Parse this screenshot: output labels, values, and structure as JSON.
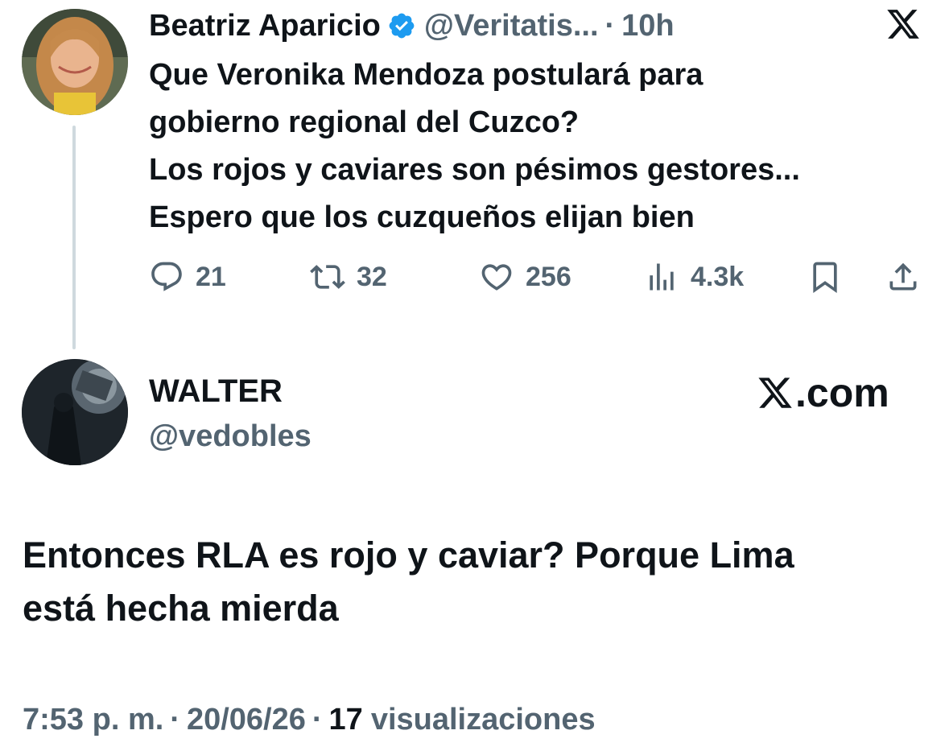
{
  "parent_tweet": {
    "author_name": "Beatriz Aparicio",
    "handle": "@Veritatis...",
    "separator": "·",
    "time": "10h",
    "text_lines": [
      "Que Veronika Mendoza postulará para",
      "gobierno regional del Cuzco?",
      "Los rojos y caviares son pésimos gestores...",
      "Espero que los cuzqueños elijan bien"
    ],
    "stats": {
      "replies": "21",
      "reposts": "32",
      "likes": "256",
      "views": "4.3k"
    }
  },
  "reply_tweet": {
    "author_name": "WALTER",
    "handle": "@vedobles",
    "brand_suffix": ".com",
    "text_lines": [
      "Entonces RLA es rojo y caviar? Porque Lima",
      "está hecha mierda"
    ],
    "timestamp": "7:53 p. m.",
    "separator": "·",
    "date": "20/06/26",
    "views_count": "17",
    "views_label": "visualizaciones"
  },
  "icons": {
    "verified": "verified-badge-icon",
    "x_logo": "x-logo-icon",
    "reply": "reply-icon",
    "repost": "repost-icon",
    "like": "heart-icon",
    "views": "views-chart-icon",
    "bookmark": "bookmark-icon",
    "share": "share-icon"
  },
  "colors": {
    "text_primary": "#0f1419",
    "text_secondary": "#536471",
    "verified_blue": "#1d9bf0",
    "thread_line": "#cfd9de"
  }
}
